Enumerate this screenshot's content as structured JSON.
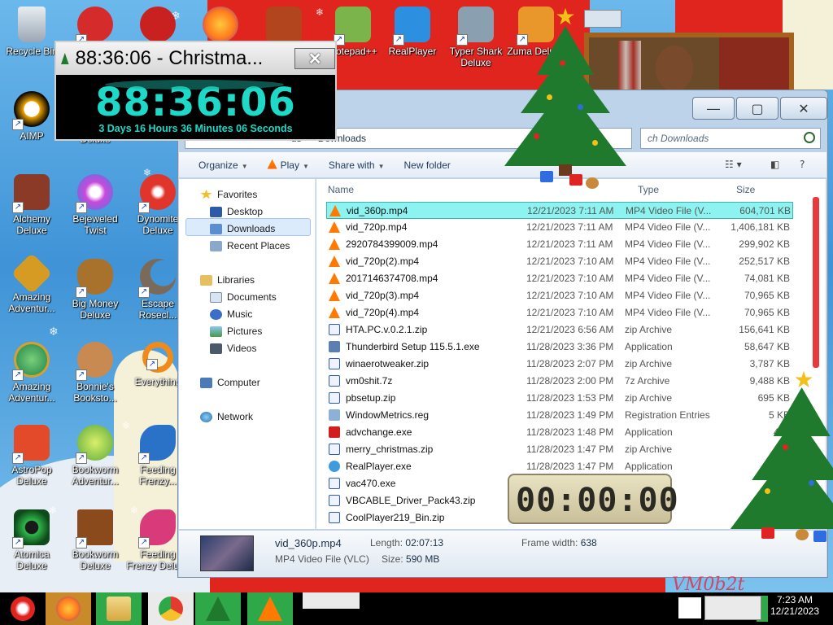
{
  "desktop": {
    "icons": [
      {
        "label": "Recycle Bin",
        "color": "#9aa7b4"
      },
      {
        "label": "",
        "color": "#d62b2b"
      },
      {
        "label": "",
        "color": "#c92020"
      },
      {
        "label": "",
        "color": "#ff7b1c"
      },
      {
        "label": "",
        "color": "#b2451e"
      },
      {
        "label": "Notepad++",
        "color": "#7bb44b"
      },
      {
        "label": "RealPlayer",
        "color": "#2d8fe0"
      },
      {
        "label": "Typer Shark Deluxe",
        "color": "#8aa0b0"
      },
      {
        "label": "Zuma Deluxe",
        "color": "#e9962a"
      },
      {
        "label": "AIMP",
        "color": "#f2a500"
      },
      {
        "label": "Deluxe",
        "color": "#3b6bd6"
      },
      {
        "label": "Alchemy Deluxe",
        "color": "#8c3a28"
      },
      {
        "label": "Bejeweled Twist",
        "color": "#c74adb"
      },
      {
        "label": "Dynomite Deluxe",
        "color": "#e0352b"
      },
      {
        "label": "Amazing Adventur...",
        "color": "#d69b22"
      },
      {
        "label": "Big Money Deluxe",
        "color": "#a8722c"
      },
      {
        "label": "Escape Rosecl...",
        "color": "#7a6a5a"
      },
      {
        "label": "Amazing Adventur...",
        "color": "#3a9a58"
      },
      {
        "label": "Bonnie's Booksto...",
        "color": "#c98a52"
      },
      {
        "label": "Everything",
        "color": "#f08a1a"
      },
      {
        "label": "AstroPop Deluxe",
        "color": "#e34a2a"
      },
      {
        "label": "Bookworm Adventur...",
        "color": "#5aa83a"
      },
      {
        "label": "Feeding Frenzy...",
        "color": "#2a72c8"
      },
      {
        "label": "Atomica Deluxe",
        "color": "#2fb84a"
      },
      {
        "label": "Bookworm Deluxe",
        "color": "#8a4a1c"
      },
      {
        "label": "Feeding Frenzy Deluxe",
        "color": "#d83a7a"
      }
    ]
  },
  "countdown": {
    "title": "88:36:06 - Christma...",
    "time": "88:36:06",
    "subtitle": "3 Days 16 Hours 36 Minutes 06 Seconds"
  },
  "explorer": {
    "breadcrumb_prev": "us",
    "breadcrumb_current": "Downloads",
    "search_placeholder": "ch Downloads",
    "toolbar": {
      "organize": "Organize",
      "play": "Play",
      "share_with": "Share with",
      "new_folder": "New folder"
    },
    "nav": {
      "favorites": "Favorites",
      "desktop": "Desktop",
      "downloads": "Downloads",
      "recent_places": "Recent Places",
      "libraries": "Libraries",
      "documents": "Documents",
      "music": "Music",
      "pictures": "Pictures",
      "videos": "Videos",
      "computer": "Computer",
      "network": "Network"
    },
    "columns": {
      "name": "Name",
      "date": "",
      "type": "Type",
      "size": "Size"
    },
    "files": [
      {
        "name": "vid_360p.mp4",
        "date": "12/21/2023 7:11 AM",
        "type": "MP4 Video File (V...",
        "size": "604,701 KB",
        "icon": "vlc",
        "selected": true
      },
      {
        "name": "vid_720p.mp4",
        "date": "12/21/2023 7:11 AM",
        "type": "MP4 Video File (V...",
        "size": "1,406,181 KB",
        "icon": "vlc"
      },
      {
        "name": "2920784399009.mp4",
        "date": "12/21/2023 7:11 AM",
        "type": "MP4 Video File (V...",
        "size": "299,902 KB",
        "icon": "vlc"
      },
      {
        "name": "vid_720p(2).mp4",
        "date": "12/21/2023 7:10 AM",
        "type": "MP4 Video File (V...",
        "size": "252,517 KB",
        "icon": "vlc"
      },
      {
        "name": "2017146374708.mp4",
        "date": "12/21/2023 7:10 AM",
        "type": "MP4 Video File (V...",
        "size": "74,081 KB",
        "icon": "vlc"
      },
      {
        "name": "vid_720p(3).mp4",
        "date": "12/21/2023 7:10 AM",
        "type": "MP4 Video File (V...",
        "size": "70,965 KB",
        "icon": "vlc"
      },
      {
        "name": "vid_720p(4).mp4",
        "date": "12/21/2023 7:10 AM",
        "type": "MP4 Video File (V...",
        "size": "70,965 KB",
        "icon": "vlc"
      },
      {
        "name": "HTA.PC.v.0.2.1.zip",
        "date": "12/21/2023 6:56 AM",
        "type": "zip Archive",
        "size": "156,641 KB",
        "icon": "zip"
      },
      {
        "name": "Thunderbird Setup 115.5.1.exe",
        "date": "11/28/2023 3:36 PM",
        "type": "Application",
        "size": "58,647 KB",
        "icon": "exe"
      },
      {
        "name": "winaerotweaker.zip",
        "date": "11/28/2023 2:07 PM",
        "type": "zip Archive",
        "size": "3,787 KB",
        "icon": "zip"
      },
      {
        "name": "vm0shit.7z",
        "date": "11/28/2023 2:00 PM",
        "type": "7z Archive",
        "size": "9,488 KB",
        "icon": "zip"
      },
      {
        "name": "pbsetup.zip",
        "date": "11/28/2023 1:53 PM",
        "type": "zip Archive",
        "size": "695 KB",
        "icon": "zip"
      },
      {
        "name": "WindowMetrics.reg",
        "date": "11/28/2023 1:49 PM",
        "type": "Registration Entries",
        "size": "5 KB",
        "icon": "reg"
      },
      {
        "name": "advchange.exe",
        "date": "11/28/2023 1:48 PM",
        "type": "Application",
        "size": "458",
        "icon": "adv"
      },
      {
        "name": "merry_christmas.zip",
        "date": "11/28/2023 1:47 PM",
        "type": "zip Archive",
        "size": "3,6",
        "icon": "zip"
      },
      {
        "name": "RealPlayer.exe",
        "date": "11/28/2023 1:47 PM",
        "type": "Application",
        "size": "",
        "icon": "rp"
      },
      {
        "name": "vac470.exe",
        "date": "11/28/2023",
        "type": "",
        "size": "",
        "icon": "zip"
      },
      {
        "name": "VBCABLE_Driver_Pack43.zip",
        "date": "11/28/2023",
        "type": "ive",
        "size": "",
        "icon": "zip"
      },
      {
        "name": "CoolPlayer219_Bin.zip",
        "date": "11/28/2023",
        "type": "ive",
        "size": "",
        "icon": "zip"
      }
    ],
    "details": {
      "filename": "vid_360p.mp4",
      "filetype": "MP4 Video File (VLC)",
      "length_label": "Length:",
      "length_value": "02:07:13",
      "size_label": "Size:",
      "size_value": "590 MB",
      "frame_label": "Frame width:",
      "frame_value": "638"
    }
  },
  "digital_clock": {
    "value": "00:00:00"
  },
  "watermark": "VM0b2t",
  "taskbar": {
    "clock_time": "7:23 AM",
    "clock_date": "12/21/2023"
  }
}
